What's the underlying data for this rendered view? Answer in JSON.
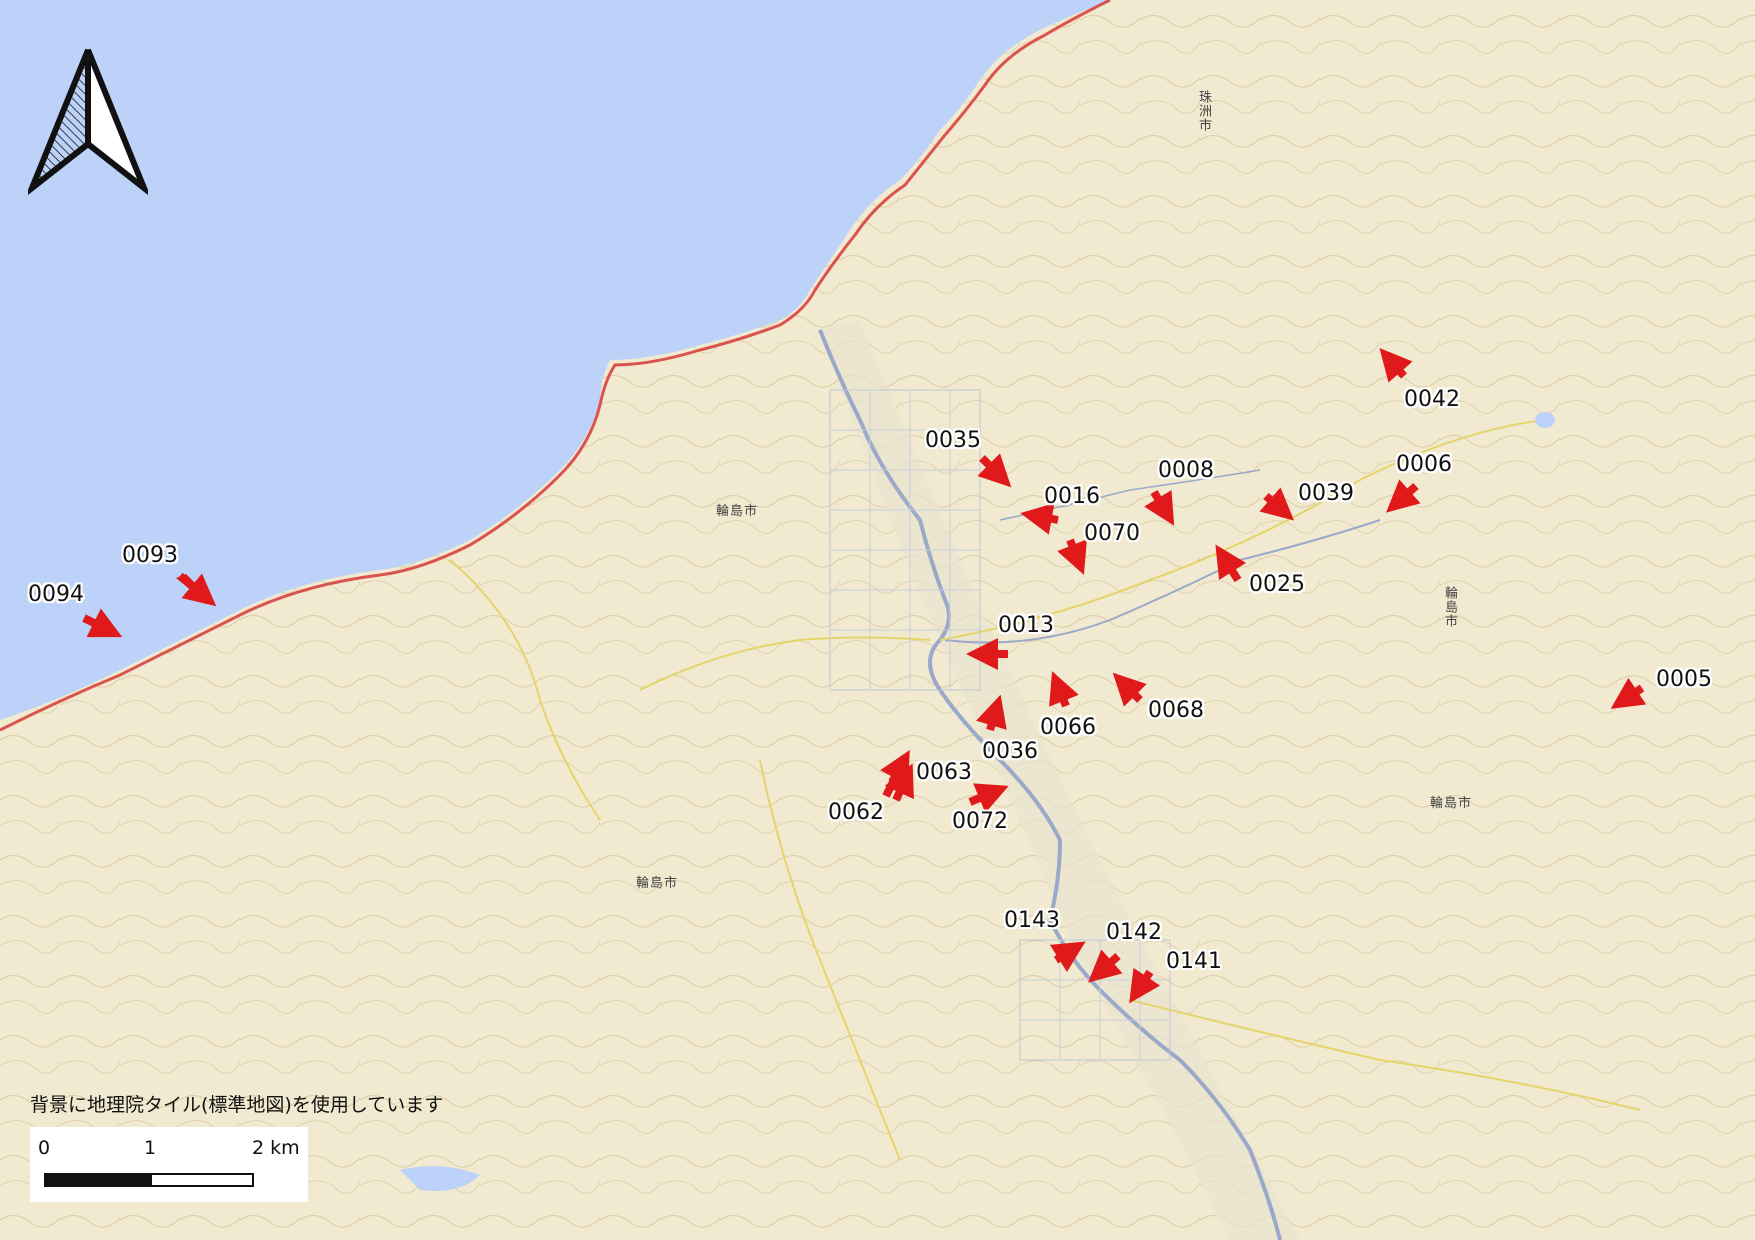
{
  "attribution": "背景に地理院タイル(標準地図)を使用しています",
  "scale": {
    "ticks": [
      "0",
      "1",
      "2 km"
    ]
  },
  "north_arrow": {
    "icon": "north-arrow-icon"
  },
  "colors": {
    "sea": "#bcd2f8",
    "land": "#f1ead0",
    "marker": "#e0191b",
    "coast_road": "#d9534f",
    "rivers": "#9aa9c9"
  },
  "place_labels": [
    {
      "id": "wajima-1",
      "text": "輪島市"
    },
    {
      "id": "wajima-2",
      "text": "輪島市"
    },
    {
      "id": "wajima-3",
      "text": "輪島市"
    },
    {
      "id": "wajima-4",
      "text": "輪島市"
    },
    {
      "id": "suzu",
      "text": "珠洲市"
    }
  ],
  "photo_points": [
    {
      "id": "0093",
      "label": "0093"
    },
    {
      "id": "0094",
      "label": "0094"
    },
    {
      "id": "0035",
      "label": "0035"
    },
    {
      "id": "0016",
      "label": "0016"
    },
    {
      "id": "0008",
      "label": "0008"
    },
    {
      "id": "0039",
      "label": "0039"
    },
    {
      "id": "0006",
      "label": "0006"
    },
    {
      "id": "0042",
      "label": "0042"
    },
    {
      "id": "0070",
      "label": "0070"
    },
    {
      "id": "0025",
      "label": "0025"
    },
    {
      "id": "0013",
      "label": "0013"
    },
    {
      "id": "0068",
      "label": "0068"
    },
    {
      "id": "0066",
      "label": "0066"
    },
    {
      "id": "0036",
      "label": "0036"
    },
    {
      "id": "0005",
      "label": "0005"
    },
    {
      "id": "0063",
      "label": "0063"
    },
    {
      "id": "0062",
      "label": "0062"
    },
    {
      "id": "0072",
      "label": "0072"
    },
    {
      "id": "0143",
      "label": "0143"
    },
    {
      "id": "0142",
      "label": "0142"
    },
    {
      "id": "0141",
      "label": "0141"
    }
  ]
}
